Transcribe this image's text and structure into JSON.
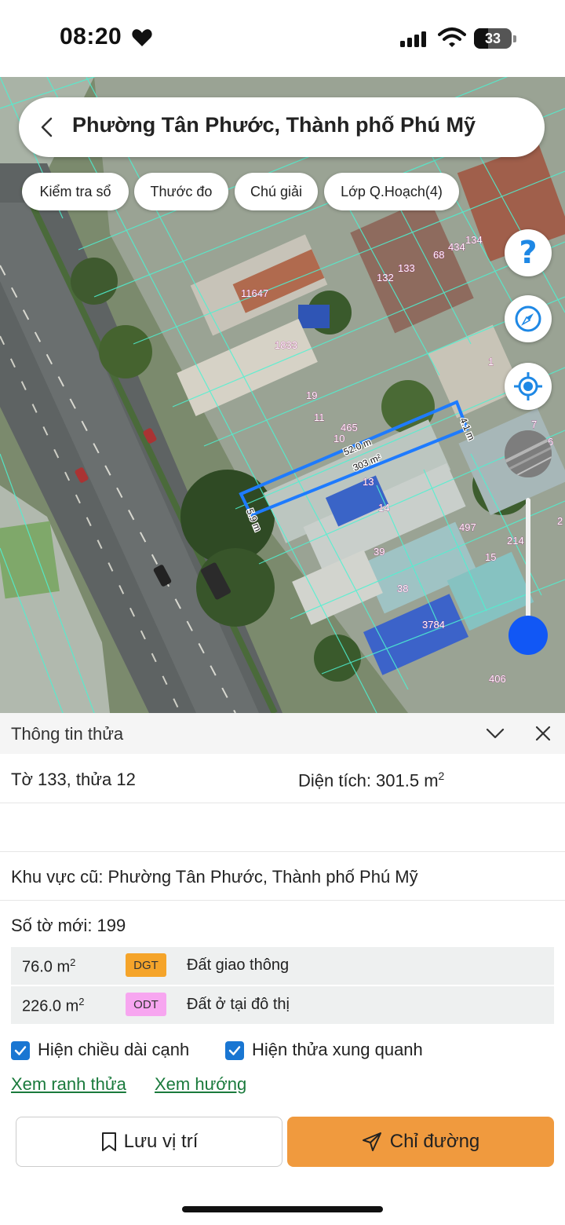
{
  "status_bar": {
    "time": "08:20",
    "battery_level": "33",
    "icons": [
      "heart-icon",
      "signal-icon",
      "wifi-icon",
      "battery-icon"
    ]
  },
  "search": {
    "location": "Phường Tân Phước, Thành phố Phú Mỹ"
  },
  "chips": [
    {
      "label": "Kiểm tra sổ"
    },
    {
      "label": "Thước đo"
    },
    {
      "label": "Chú giải"
    },
    {
      "label": "Lớp Q.Hoạch(4)"
    }
  ],
  "map_controls": {
    "help": "?",
    "icons": [
      "help-icon",
      "compass-icon",
      "locate-icon",
      "layer-icon",
      "zoom-slider"
    ]
  },
  "map_labels": {
    "parcels": [
      "11647",
      "1833",
      "132",
      "133",
      "68",
      "434",
      "134",
      "19",
      "11",
      "465",
      "10",
      "13",
      "14",
      "39",
      "38",
      "497",
      "214",
      "15",
      "3784",
      "406",
      "1",
      "7",
      "6",
      "2"
    ],
    "edge_long": "52.0 m",
    "edge_area": "303 m²",
    "edge_side_right": "4.1 m",
    "edge_side_left": "5.9 m"
  },
  "panel": {
    "title": "Thông tin thửa",
    "sheet_parcel": "Tờ 133, thửa 12",
    "area_label": "Diện tích: 301.5 m",
    "area_sup": "2",
    "old_area": "Khu vực cũ: Phường Tân Phước, Thành phố Phú Mỹ",
    "new_sheet": "Số tờ mới: 199",
    "usage": [
      {
        "area": "76.0 m",
        "sup": "2",
        "code": "DGT",
        "desc": "Đất giao thông",
        "color": "#f5a42a"
      },
      {
        "area": "226.0 m",
        "sup": "2",
        "code": "ODT",
        "desc": "Đất ở tại đô thị",
        "color": "#f7a6f0"
      }
    ],
    "checkboxes": [
      {
        "label": "Hiện chiều dài cạnh",
        "checked": true
      },
      {
        "label": "Hiện thửa xung quanh",
        "checked": true
      }
    ],
    "links": [
      "Xem ranh thửa",
      "Xem hướng"
    ],
    "save_label": "Lưu vị trí",
    "directions_label": "Chỉ đường"
  },
  "colors": {
    "accent_orange": "#f09a3e",
    "parcel_outline": "#1e7bff",
    "link_green": "#1a7a3c",
    "checkbox_blue": "#1976d2"
  }
}
